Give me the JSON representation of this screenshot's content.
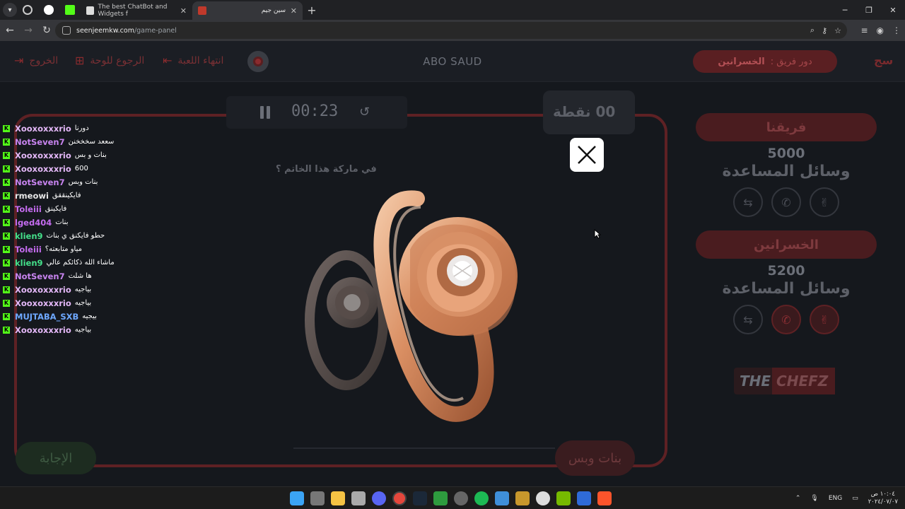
{
  "browser": {
    "tabs": [
      {
        "title": "The best ChatBot and Widgets f"
      },
      {
        "title": "سين جيم"
      }
    ],
    "url_host": "seenjeemkw.com",
    "url_path": "/game-panel"
  },
  "topbar": {
    "logout_label": "الخروج",
    "back_label": "الرجوع للوحة",
    "end_game_label": "انتهاء اللعبة",
    "player_name": "ABO SAUD",
    "turn_prefix": "دور فريق :",
    "turn_team": "الخسرانين"
  },
  "game": {
    "timer": "00:23",
    "points_text": "00 نقطة",
    "question": "في ماركة هذا الخاتم ؟",
    "answer_button": "الإجابة",
    "answer_reveal": "بنات وبس"
  },
  "teams": [
    {
      "name": "فريقنا",
      "score": "5000",
      "help_title": "وسائل المساعدة"
    },
    {
      "name": "الخسرانين",
      "score": "5200",
      "help_title": "وسائل المساعدة"
    }
  ],
  "sponsor": {
    "part1": "THE",
    "part2": "CHEFZ"
  },
  "chat": [
    {
      "user": "Xooxoxxxrio",
      "color": "#e3b7f7",
      "msg": "دورنا"
    },
    {
      "user": "NotSeven7",
      "color": "#c884f0",
      "msg": "سععد سخخخنن"
    },
    {
      "user": "Xooxoxxxrio",
      "color": "#e3b7f7",
      "msg": "بنات و بس"
    },
    {
      "user": "Xooxoxxxrio",
      "color": "#e3b7f7",
      "msg": "600"
    },
    {
      "user": "NotSeven7",
      "color": "#c884f0",
      "msg": "بنات وبس"
    },
    {
      "user": "rmeowi",
      "color": "#e7e7e7",
      "msg": "فايكينققق"
    },
    {
      "user": "Toleiii",
      "color": "#c56cf0",
      "msg": "فايكينق"
    },
    {
      "user": "lged404",
      "color": "#c56cf0",
      "msg": "بنات"
    },
    {
      "user": "klien9",
      "color": "#44e08a",
      "msg": "حطو فايكنق ي بنات"
    },
    {
      "user": "Toleiii",
      "color": "#c56cf0",
      "msg": "مياو متابعته؟"
    },
    {
      "user": "klien9",
      "color": "#44e08a",
      "msg": "ماشاء الله ذكائكم عالي"
    },
    {
      "user": "NotSeven7",
      "color": "#c884f0",
      "msg": "ها شلت"
    },
    {
      "user": "Xooxoxxxrio",
      "color": "#e3b7f7",
      "msg": "بياجيه"
    },
    {
      "user": "Xooxoxxxrio",
      "color": "#e3b7f7",
      "msg": "بياجيه"
    },
    {
      "user": "MUJTABA_SXB",
      "color": "#6ea8ff",
      "msg": "بيجيه"
    },
    {
      "user": "Xooxoxxxrio",
      "color": "#e3b7f7",
      "msg": "بياجيه"
    }
  ],
  "taskbar": {
    "language": "ENG",
    "time": "١٠:٠٤ ص",
    "date": "٢٠٢٤/٠٧/٠٧"
  },
  "icons": {
    "help": [
      "double-answer-icon",
      "phone-icon",
      "peace-hand-icon"
    ]
  },
  "colors": {
    "accent_red": "#5e2124",
    "chat_badge": "#53fc18"
  }
}
